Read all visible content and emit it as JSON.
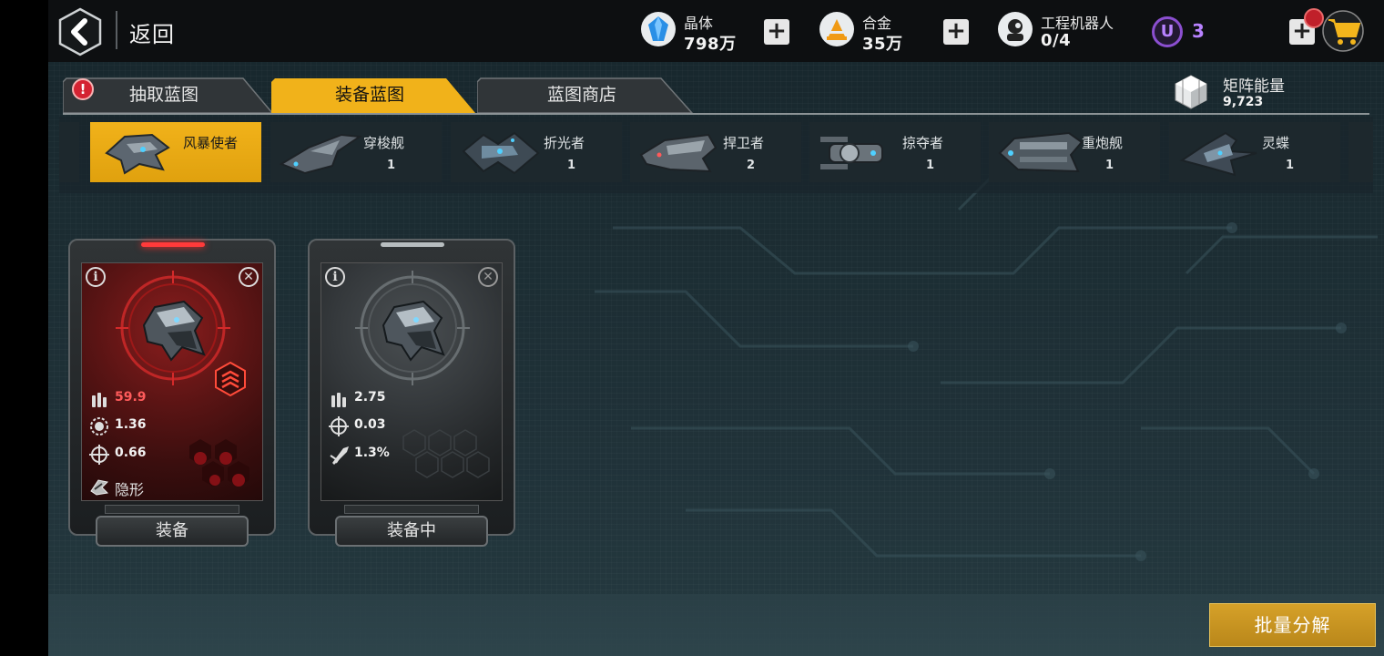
{
  "header": {
    "back_label": "返回",
    "resources": [
      {
        "name": "晶体",
        "value": "798万",
        "icon": "crystal-icon"
      },
      {
        "name": "合金",
        "value": "35万",
        "icon": "alloy-icon"
      },
      {
        "name": "工程机器人",
        "value": "0/4",
        "icon": "robot-icon"
      }
    ],
    "u_badge": "U",
    "u_count": "3"
  },
  "tabs": [
    {
      "label": "抽取蓝图",
      "active": false
    },
    {
      "label": "装备蓝图",
      "active": true
    },
    {
      "label": "蓝图商店",
      "active": false
    }
  ],
  "tab_alert": "!",
  "matrix": {
    "label": "矩阵能量",
    "value": "9,723"
  },
  "ships": [
    {
      "name": "风暴使者",
      "count": "",
      "active": true
    },
    {
      "name": "穿梭舰",
      "count": "1"
    },
    {
      "name": "折光者",
      "count": "1"
    },
    {
      "name": "捍卫者",
      "count": "2"
    },
    {
      "name": "掠夺者",
      "count": "1"
    },
    {
      "name": "重炮舰",
      "count": "1"
    },
    {
      "name": "灵蝶",
      "count": "1"
    }
  ],
  "cards": [
    {
      "style": "red",
      "stats": [
        {
          "icon": "ammo-icon",
          "value": "59.9",
          "highlight": true
        },
        {
          "icon": "fire-rate-icon",
          "value": "1.36"
        },
        {
          "icon": "crosshair-icon",
          "value": "0.66"
        },
        {
          "icon": "stealth-icon",
          "value": "隐形"
        }
      ],
      "button": "装备"
    },
    {
      "style": "gray",
      "stats": [
        {
          "icon": "ammo-icon",
          "value": "2.75"
        },
        {
          "icon": "crosshair-icon",
          "value": "0.03"
        },
        {
          "icon": "missile-icon",
          "value": "1.3%"
        }
      ],
      "button": "装备中"
    }
  ],
  "batch_button": "批量分解",
  "colors": {
    "accent": "#f1b21a",
    "alert": "#d42332",
    "purple": "#b882ff"
  }
}
